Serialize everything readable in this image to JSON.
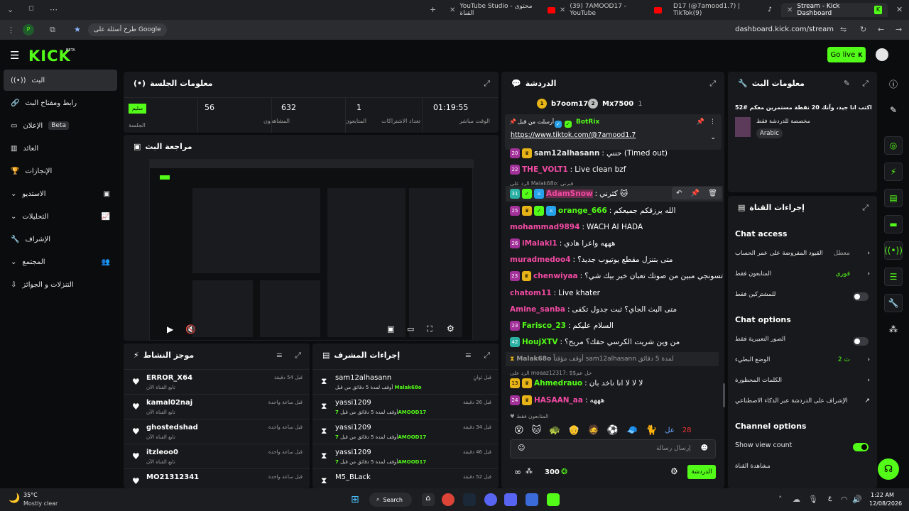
{
  "browser": {
    "tabs": [
      {
        "label": "YouTube Studio - محتوى القناة"
      },
      {
        "label": "(39) 7AMOOD17 - YouTube"
      },
      {
        "label": "D17 (@7amood1.7) | TikTok(9)"
      },
      {
        "label": "Stream - Kick Dashboard"
      }
    ],
    "ask_google": "طرح أسئلة على Google",
    "url": "dashboard.kick.com/stream"
  },
  "header": {
    "logo": "KICK",
    "logo_sup": "BETA",
    "go_live": "Go live"
  },
  "nav": {
    "items": [
      {
        "label": "البث"
      },
      {
        "label": "رابط ومفتاح البث"
      },
      {
        "label": "الإعلان",
        "badge": "Beta"
      },
      {
        "label": "العائد"
      },
      {
        "label": "الإنجازات"
      },
      {
        "label": "الاستديو"
      },
      {
        "label": "التحليلات"
      },
      {
        "label": "الإشراف"
      },
      {
        "label": "المجتمع"
      },
      {
        "label": "التنزلات و الجوائز"
      }
    ]
  },
  "session": {
    "title": "معلومات الجلسة",
    "status_chip": "سليم",
    "status_label": "الجلسة",
    "stats": [
      {
        "value": "56",
        "label": "المشاهدون"
      },
      {
        "value": "632",
        "label": "المتابعون"
      },
      {
        "value": "1",
        "label": "تعداد الاشتراكات"
      },
      {
        "value": "01:19:55",
        "label": "الوقت مباشر"
      }
    ]
  },
  "preview": {
    "title": "مراجعة البث"
  },
  "activity": {
    "title": "موجز النشاط",
    "items": [
      {
        "name": "ERROR_X64",
        "sub": "تابع القناة الآن",
        "time": "قبل 54 دقيقة"
      },
      {
        "name": "kamal02naj",
        "sub": "تابع القناة الآن",
        "time": "قبل ساعة واحدة"
      },
      {
        "name": "ghostedshad",
        "sub": "تابع القناة الآن",
        "time": "قبل ساعة واحدة"
      },
      {
        "name": "itzleoo0",
        "sub": "تابع القناة الآن",
        "time": "قبل ساعة واحدة"
      },
      {
        "name": "MO21312341",
        "sub": "",
        "time": "قبل ساعة واحدة"
      }
    ]
  },
  "mod_actions": {
    "title": "إجراءات المشرف",
    "items": [
      {
        "name": "sam12alhasann",
        "sub": "أوقف لمدة 5 دقائق من قبل",
        "by": "Malak68o",
        "time": "قبل ثوانٍ"
      },
      {
        "name": "yassi1209",
        "sub": "أوقف لمدة 5 دقائق من قبل",
        "by": "7AMOOD17",
        "time": "قبل 26 دقيقة"
      },
      {
        "name": "yassi1209",
        "sub": "أوقف لمدة 5 دقائق من قبل",
        "by": "7AMOOD17",
        "time": "قبل 34 دقيقة"
      },
      {
        "name": "yassi1209",
        "sub": "أوقف لمدة 5 دقائق من قبل",
        "by": "7AMOOD17",
        "time": "قبل 46 دقيقة"
      },
      {
        "name": "M5_BLack",
        "sub": "",
        "by": "",
        "time": "قبل 52 دقيقة"
      }
    ]
  },
  "chat": {
    "title": "الدردشة",
    "top_gifters": [
      {
        "name": "b7oom17",
        "count": "1"
      },
      {
        "name": "Mx7500",
        "count": "1"
      }
    ],
    "pinned": {
      "label": "أرسلت من قبل",
      "user": "BotRix",
      "link": "https://www.tiktok.com/@7amood1.7"
    },
    "messages": [
      {
        "user": "sam12alhasann",
        "text": "حنني (Timed out)",
        "color": "#e6e6e6"
      },
      {
        "user": "THE_VOLT1",
        "text": "Live clean bzf",
        "color": "#f14aa3"
      },
      {
        "user": "AdamSnow",
        "text": "كثرني 🐱",
        "color": "#f14aa3",
        "reply": "الرد على Malak68o: قبرني"
      },
      {
        "user": "orange_666",
        "text": "الله يرزقكم جميعكم",
        "color": "#53fc18"
      },
      {
        "user": "mohammad9894",
        "text": "WACH AI HADA",
        "color": "#f14aa3"
      },
      {
        "user": "iMalaki1",
        "text": "هههه واعرا هادي",
        "color": "#f14aa3"
      },
      {
        "user": "muradmedoo4",
        "text": "متى بتنزل مقطع يوتيوب جديد؟",
        "color": "#f14aa3"
      },
      {
        "user": "chenwiyaa",
        "text": "تسونجي مبين من صوتك تعبان خير بيك شي؟",
        "color": "#f14aa3"
      },
      {
        "user": "chatom11",
        "text": "Live khater",
        "color": "#f14aa3"
      },
      {
        "user": "Amine_sanba",
        "text": "متى البث الجاي؟ ثبت جدول تكفى",
        "color": "#f14aa3"
      },
      {
        "user": "Farisco_23",
        "text": "السلام عليكم",
        "color": "#53fc18"
      },
      {
        "user": "HoujXTV",
        "text": "من وين شريت الكرسي حقك؟ مريح؟",
        "color": "#53fc18"
      },
      {
        "user": "Malak68o",
        "text": "أوقف مؤقتاً sam12alhasann لمدة 5 دقائق",
        "color": "#9b9b9b"
      },
      {
        "user": "Ahmedrauo",
        "text": "لا لا لا انا ناخد بان",
        "color": "#53fc18",
        "reply": "الرد على moaaz12317: $$حل عم"
      },
      {
        "user": "HASAAN_aa",
        "text": "هههه",
        "color": "#f14aa3"
      }
    ],
    "followers_only": "المتابعون فقط",
    "input_placeholder": "إرسال رسالة",
    "points": "300",
    "send_label": "الدردشة"
  },
  "stream_info": {
    "title": "معلومات البث",
    "stream_title": "اكتب انا جيد، وآنك 20 نقطة مستمرين معكم #52",
    "category": "مخصصة للدردشة فقط",
    "language": "Arabic"
  },
  "channel_actions": {
    "title": "إجراءات القناة",
    "chat_access_head": "Chat access",
    "chat_access": [
      {
        "label": "القيود المفروضة على عمر الحساب",
        "value": "معطل"
      },
      {
        "label": "المتابعون فقط",
        "value": "فوري"
      },
      {
        "label": "للمشتركين فقط",
        "value": ""
      }
    ],
    "chat_options_head": "Chat options",
    "chat_options": [
      {
        "label": "الصور التعبيرية فقط",
        "value": ""
      },
      {
        "label": "الوضع البطيء",
        "value": "2 ث"
      },
      {
        "label": "الكلمات المحظورة",
        "value": ""
      },
      {
        "label": "الإشراف على الدردشة عبر الذكاء الاصطناعي",
        "value": ""
      }
    ],
    "channel_options_head": "Channel options",
    "show_view_count": "Show view count",
    "view_channel": "مشاهدة القناة"
  },
  "taskbar": {
    "temp": "35°C",
    "weather": "Mostly clear",
    "search": "Search",
    "time": "1:22 AM",
    "date": "12/08/2026",
    "lang": "ع"
  },
  "colors": {
    "accent": "#53fc18",
    "panel": "#18191c",
    "bg": "#0b0c0e"
  }
}
